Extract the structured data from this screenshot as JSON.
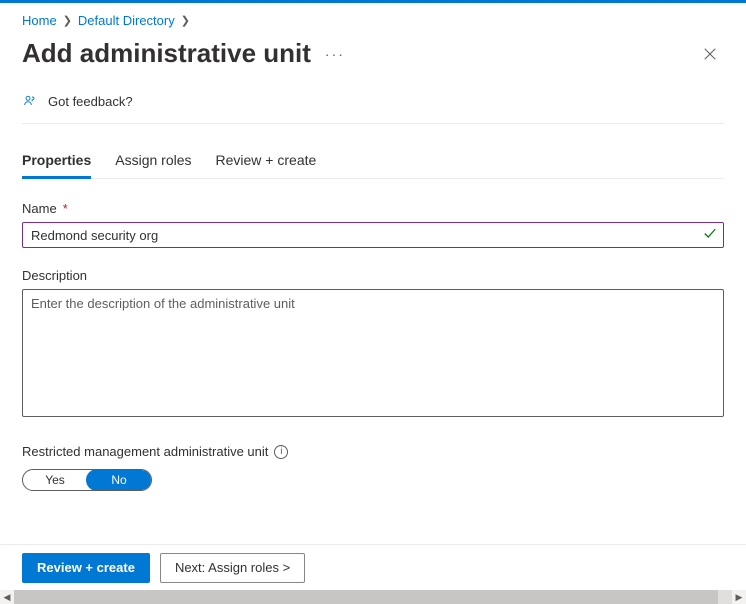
{
  "breadcrumb": {
    "home": "Home",
    "dir": "Default Directory"
  },
  "title": "Add administrative unit",
  "feedback_label": "Got feedback?",
  "tabs": {
    "properties": "Properties",
    "assign_roles": "Assign roles",
    "review_create": "Review + create"
  },
  "form": {
    "name_label": "Name",
    "name_value": "Redmond security org",
    "desc_label": "Description",
    "desc_placeholder": "Enter the description of the administrative unit",
    "restricted_label": "Restricted management administrative unit",
    "toggle_yes": "Yes",
    "toggle_no": "No"
  },
  "footer": {
    "primary": "Review + create",
    "secondary": "Next: Assign roles >"
  }
}
